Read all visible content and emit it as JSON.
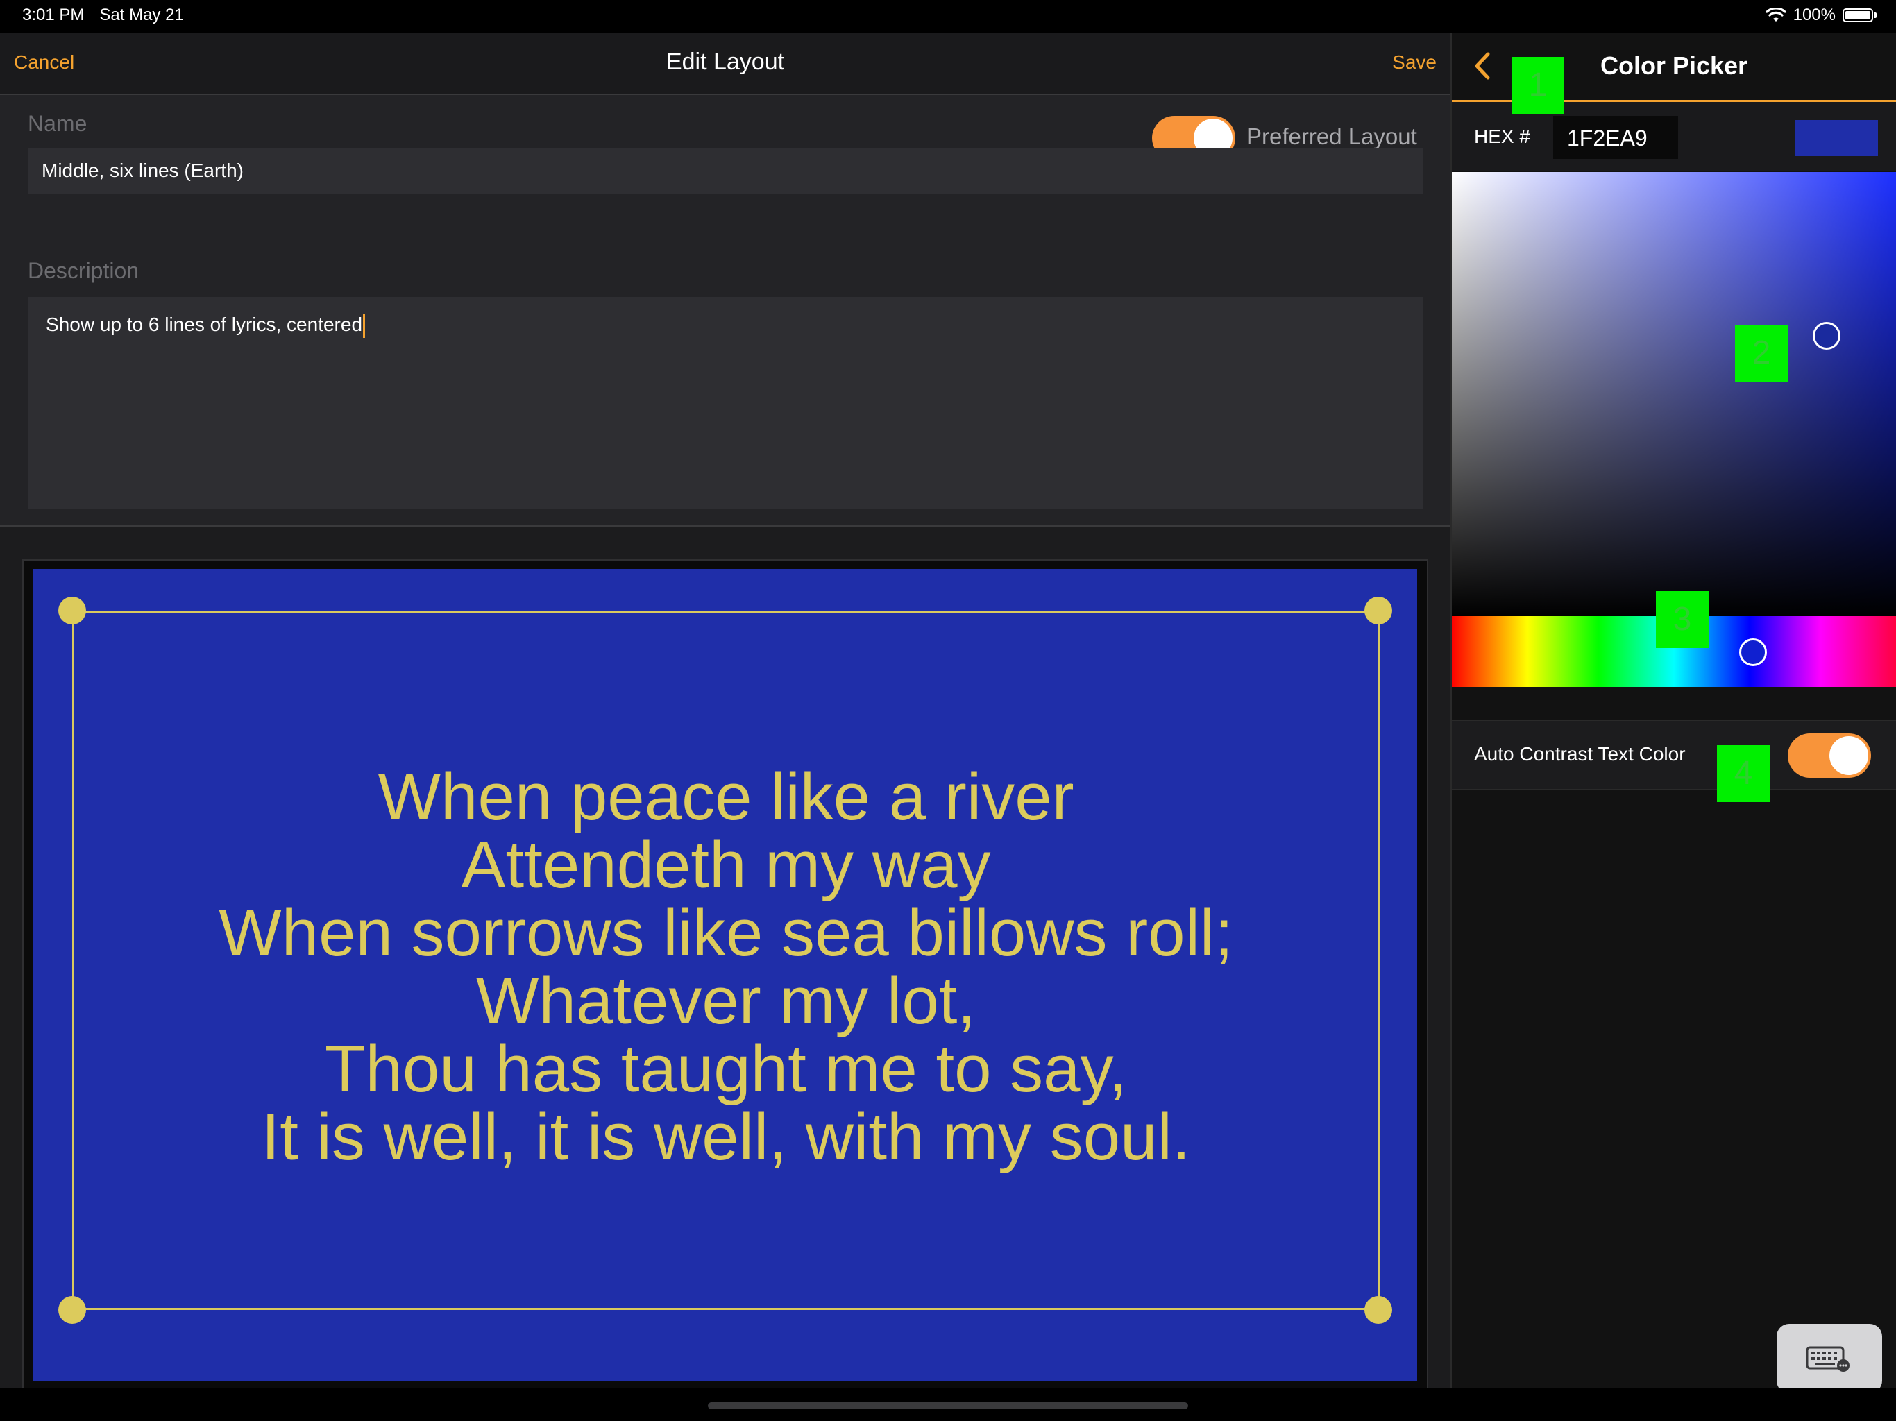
{
  "status_bar": {
    "time": "3:01 PM",
    "date": "Sat May 21",
    "battery": "100%",
    "wifi_icon": "wifi-icon",
    "battery_icon": "battery-icon"
  },
  "nav": {
    "cancel_label": "Cancel",
    "title": "Edit Layout",
    "save_label": "Save"
  },
  "form": {
    "name_label": "Name",
    "name_value": "Middle, six lines (Earth)",
    "preferred_label": "Preferred Layout",
    "preferred_on": true,
    "description_label": "Description",
    "description_value": "Show up to 6 lines of lyrics, centered"
  },
  "preview": {
    "background_color": "#1f2ea9",
    "text_color": "#dccb5c",
    "lines": [
      "When peace like a river",
      "Attendeth my way",
      "When sorrows like sea billows roll;",
      "Whatever my lot,",
      "Thou has taught me to say,",
      "It is well, it is well, with my soul."
    ]
  },
  "color_picker": {
    "title": "Color Picker",
    "hex_label": "HEX #",
    "hex_value": "1F2EA9",
    "swatch_color": "#1f2ea9",
    "auto_contrast_label": "Auto Contrast Text Color",
    "auto_contrast_on": true,
    "markers": [
      "1",
      "2",
      "3",
      "4"
    ]
  },
  "colors": {
    "accent": "#f4a22f",
    "toggle_on": "#f8943a",
    "marker_green": "#00f000"
  }
}
